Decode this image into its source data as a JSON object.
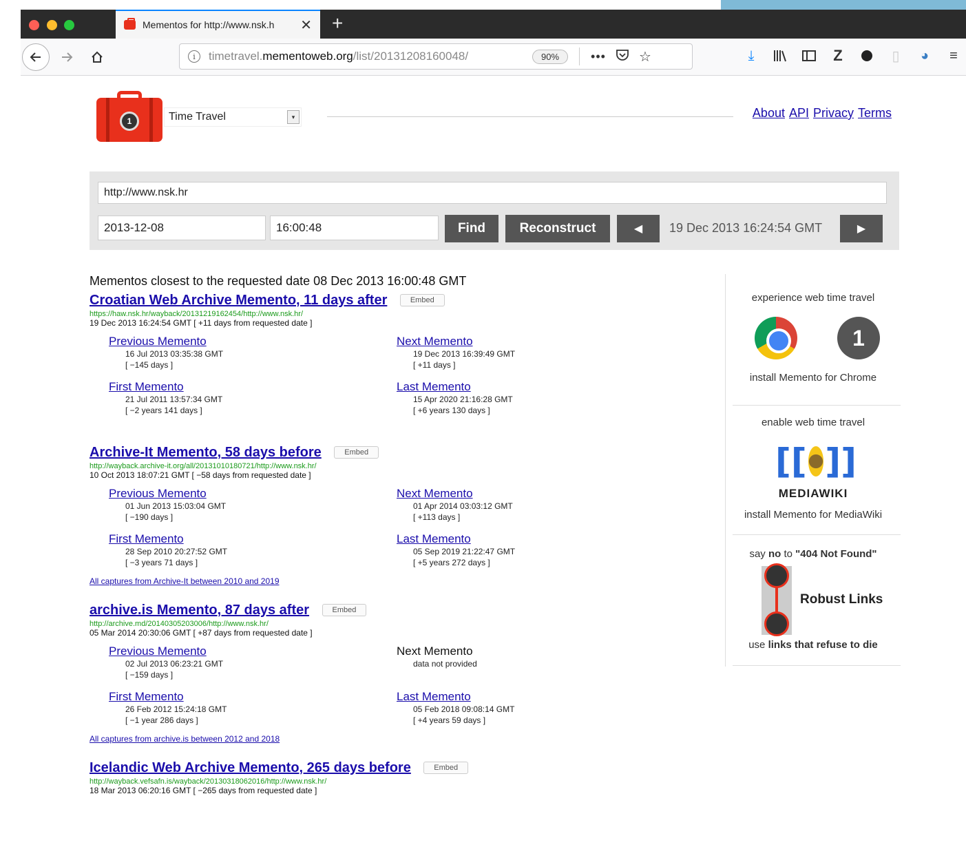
{
  "browser": {
    "tab_title": "Mementos for http://www.nsk.h",
    "tab_close": "✕",
    "new_tab": "+",
    "url_prefix": "timetravel.",
    "url_domain": "mementoweb.org",
    "url_path": "/list/20131208160048/",
    "zoom": "90%",
    "more": "•••"
  },
  "header": {
    "select_value": "Time Travel",
    "links": [
      "About",
      "API",
      "Privacy",
      "Terms"
    ]
  },
  "search": {
    "url_value": "http://www.nsk.hr",
    "date_value": "2013-12-08",
    "time_value": "16:00:48",
    "find_label": "Find",
    "reconstruct_label": "Reconstruct",
    "prev_glyph": "◀",
    "next_glyph": "▶",
    "current_date": "19 Dec 2013 16:24:54 GMT"
  },
  "results": {
    "intro": "Mementos closest to the requested date 08 Dec 2013 16:00:48 GMT",
    "embed_label": "Embed",
    "items": [
      {
        "title": "Croatian Web Archive Memento, 11 days after",
        "url": "https://haw.nsk.hr/wayback/20131219162454/http://www.nsk.hr/",
        "date": "19 Dec 2013 16:24:54 GMT  [ +11 days from requested date ]",
        "prev_label": "Previous Memento",
        "prev_date": "16 Jul 2013 03:35:38 GMT",
        "prev_delta": "[ −145 days ]",
        "next_label": "Next Memento",
        "next_date": "19 Dec 2013 16:39:49 GMT",
        "next_delta": "[ +11 days ]",
        "first_label": "First Memento",
        "first_date": "21 Jul 2011 13:57:34 GMT",
        "first_delta": "[ −2 years 141 days ]",
        "last_label": "Last Memento",
        "last_date": "15 Apr 2020 21:16:28 GMT",
        "last_delta": "[ +6 years 130 days ]"
      },
      {
        "title": "Archive-It Memento, 58 days before",
        "url": "http://wayback.archive-it.org/all/20131010180721/http://www.nsk.hr/",
        "date": "10 Oct 2013 18:07:21 GMT  [ −58 days from requested date ]",
        "prev_label": "Previous Memento",
        "prev_date": "01 Jun 2013 15:03:04 GMT",
        "prev_delta": "[ −190 days ]",
        "next_label": "Next Memento",
        "next_date": "01 Apr 2014 03:03:12 GMT",
        "next_delta": "[ +113 days ]",
        "first_label": "First Memento",
        "first_date": "28 Sep 2010 20:27:52 GMT",
        "first_delta": "[ −3 years 71 days ]",
        "last_label": "Last Memento",
        "last_date": "05 Sep 2019 21:22:47 GMT",
        "last_delta": "[ +5 years 272 days ]",
        "all_captures": "All captures from Archive-It between 2010 and 2019"
      },
      {
        "title": "archive.is Memento, 87 days after",
        "url": "http://archive.md/20140305203006/http://www.nsk.hr/",
        "date": "05 Mar 2014 20:30:06 GMT  [ +87 days from requested date ]",
        "prev_label": "Previous Memento",
        "prev_date": "02 Jul 2013 06:23:21 GMT",
        "prev_delta": "[ −159 days ]",
        "next_label": "Next Memento",
        "next_date": "data not provided",
        "first_label": "First Memento",
        "first_date": "26 Feb 2012 15:24:18 GMT",
        "first_delta": "[ −1 year 286 days ]",
        "last_label": "Last Memento",
        "last_date": "05 Feb 2018 09:08:14 GMT",
        "last_delta": "[ +4 years 59 days ]",
        "all_captures": "All captures from archive.is between 2012 and 2018"
      },
      {
        "title": "Icelandic Web Archive Memento, 265 days before",
        "url": "http://wayback.vefsafn.is/wayback/20130318062016/http://www.nsk.hr/",
        "date": "18 Mar 2013 06:20:16 GMT  [ −265 days from requested date ]"
      }
    ]
  },
  "sidebar": {
    "chrome_heading": "experience web time travel",
    "chrome_install": "install Memento for Chrome",
    "mw_heading": "enable web time travel",
    "mw_wordmark": "MEDIAWIKI",
    "mw_install": "install Memento for MediaWiki",
    "rl_say": "say",
    "rl_no": "no",
    "rl_to": "to",
    "rl_404": "\"404 Not Found\"",
    "rl_label": "Robust Links",
    "rl_use": "use",
    "rl_links_refuse": "links that refuse to die"
  }
}
